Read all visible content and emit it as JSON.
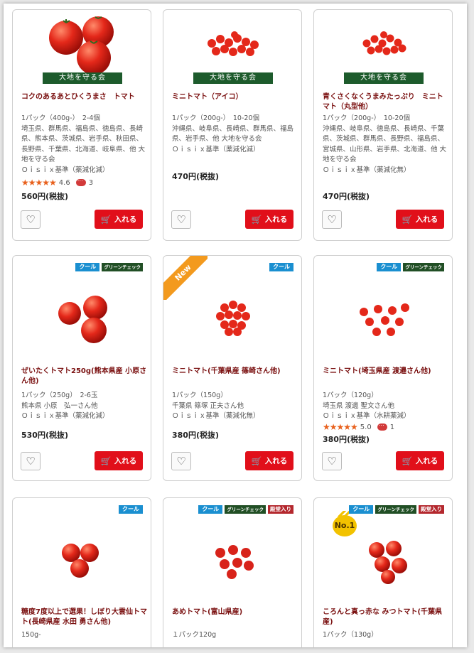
{
  "ui": {
    "badge_cool": "クール",
    "badge_green": "グリーンチェック",
    "badge_hof": "殿堂入り",
    "badge_new": "New",
    "badge_no1": "No.1",
    "daichi_label": "大地を守る会",
    "cart_label": "入れる",
    "icons": {
      "favorite": "heart-icon",
      "cart": "cart-icon",
      "comment": "speech-bubble-icon",
      "rating": "star-icon"
    }
  },
  "colors": {
    "cart_button": "#e10f1a",
    "product_name": "#7a1010",
    "cool_badge": "#1a8fd0",
    "green_badge": "#214f25",
    "hof_badge": "#b4282e",
    "new_ribbon": "#f39a1e",
    "stars": "#e8601c"
  },
  "products": [
    {
      "name": "コクのあるあとひくうまさ　トマト",
      "spec": [
        "1パック（400g-）　2-4個",
        "埼玉県、群馬県、福島県、徳島県、長崎県、熊本県、茨城県、岩手県、秋田県、長野県、千葉県、北海道、岐阜県、他 大地を守る会",
        "Ｏｉｓｉｘ基準（薬減化減）"
      ],
      "rating": "4.6",
      "comments": "3",
      "price": "560円(税抜)"
    },
    {
      "name": "ミニトマト（アイコ）",
      "spec": [
        "1パック（200g-）　10-20個",
        "沖縄県、岐阜県、長崎県、群馬県、福島県、岩手県、他 大地を守る会",
        "Ｏｉｓｉｘ基準（薬減化減）"
      ],
      "price": "470円(税抜)"
    },
    {
      "name": "青くさくなくうまみたっぷり　ミニトマト（丸型他）",
      "spec": [
        "1パック（200g-）　10-20個",
        "沖縄県、岐阜県、徳島県、長崎県、千葉県、茨城県、群馬県、長野県、福島県、宮城県、山形県、岩手県、北海道、他 大地を守る会",
        "Ｏｉｓｉｘ基準（薬減化無）"
      ],
      "price": "470円(税抜)"
    },
    {
      "name": "ぜいたくトマト250g(熊本県産 小原さん他)",
      "spec": [
        "1パック（250g）　2-6玉",
        "熊本県 小原　弘一さん他",
        "Ｏｉｓｉｘ基準（薬減化減）"
      ],
      "price": "530円(税抜)"
    },
    {
      "name": "ミニトマト(千葉県産 篠崎さん他)",
      "spec": [
        "1パック（150g）",
        "千葉県 篠塚 正夫さん他",
        "Ｏｉｓｉｘ基準（薬減化無）"
      ],
      "price": "380円(税抜)"
    },
    {
      "name": "ミニトマト(埼玉県産 渡邉さん他)",
      "spec": [
        "1パック（120g）",
        "埼玉県 渡邊 聖文さん他",
        "Ｏｉｓｉｘ基準（水耕薬減）"
      ],
      "rating": "5.0",
      "comments": "1",
      "price": "380円(税抜)"
    },
    {
      "name": "糖度7度以上で選果！しぼり大雲仙トマト(長崎県産 水田 勇さん他)",
      "spec": [
        "150g-"
      ]
    },
    {
      "name": "あめトマト(富山県産)",
      "spec": [
        "１パック120g"
      ]
    },
    {
      "name": "ころんと真っ赤な みつトマト(千葉県産)",
      "spec": [
        "1パック（130g）"
      ]
    }
  ]
}
